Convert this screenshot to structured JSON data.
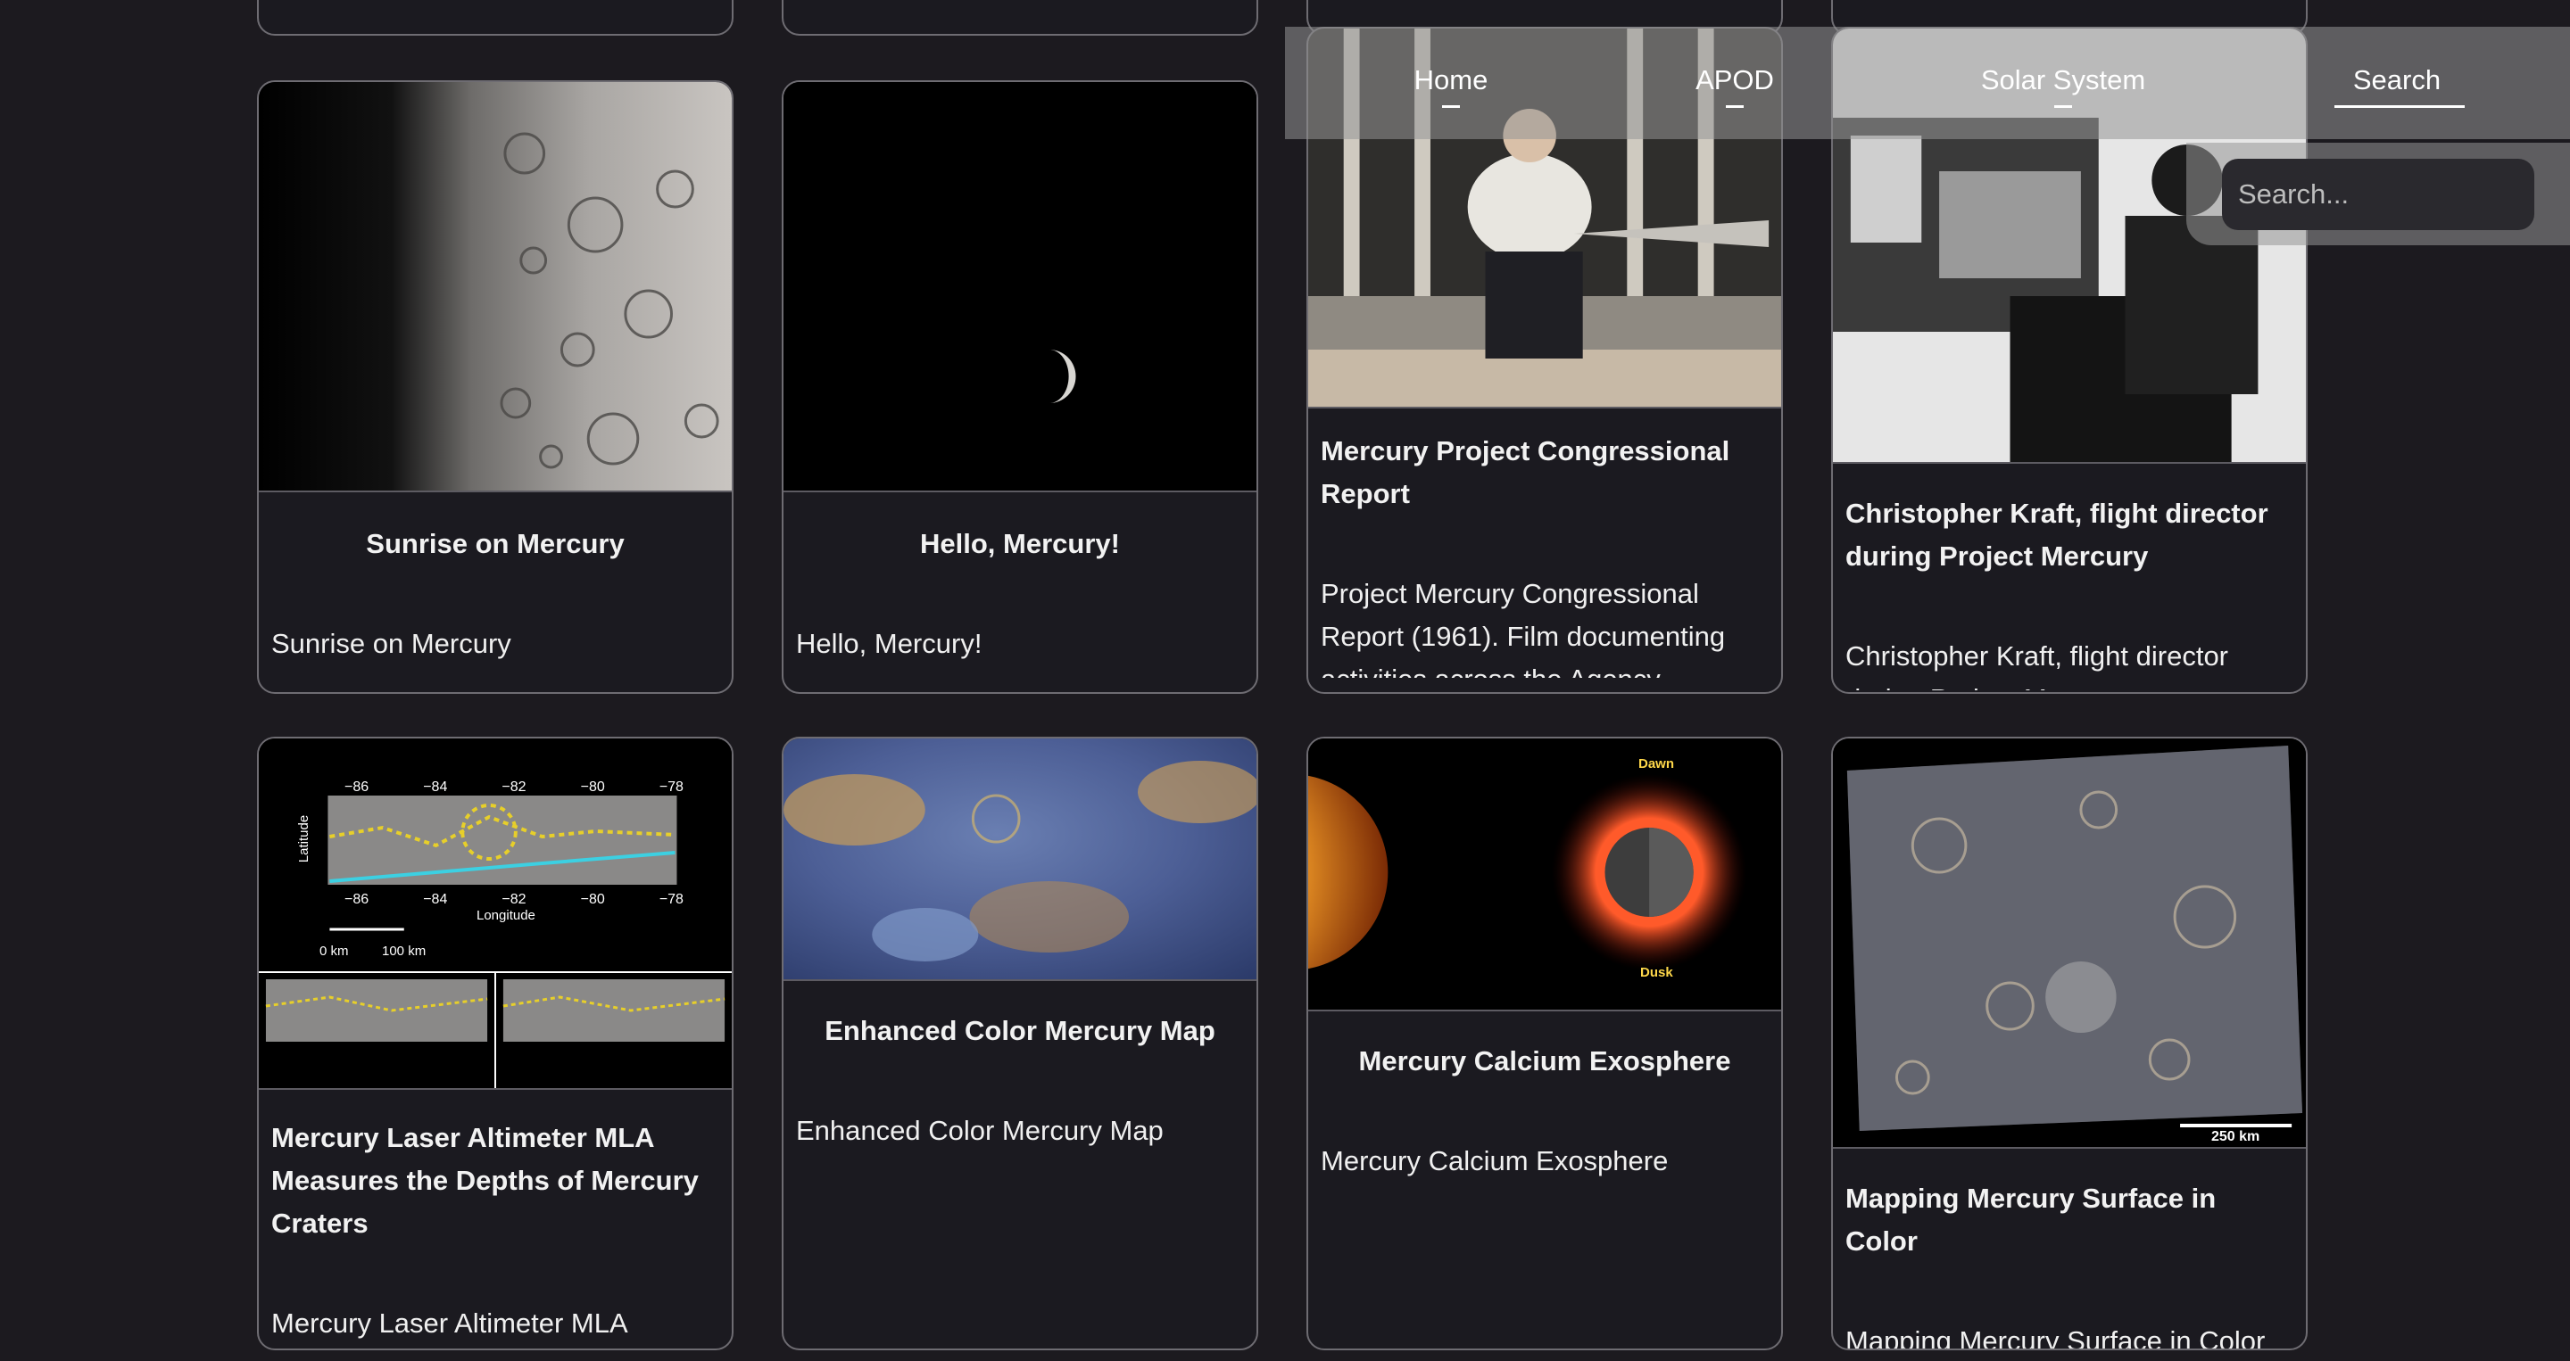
{
  "nav": {
    "items": [
      {
        "label": "Home"
      },
      {
        "label": "APOD"
      },
      {
        "label": "Solar System"
      },
      {
        "label": "Search"
      }
    ],
    "active": "Search",
    "search_placeholder": "Search..."
  },
  "cards": [
    {
      "title": "Sunrise on Mercury",
      "description": "Sunrise on Mercury"
    },
    {
      "title": "Hello, Mercury!",
      "description": "Hello, Mercury!"
    },
    {
      "title": "Mercury Project Congressional Report",
      "description": "Project Mercury Congressional Report (1961). Film documenting activities across the Agency"
    },
    {
      "title": "Christopher Kraft, flight director during Project Mercury",
      "description": "Christopher Kraft, flight director during Project Mercury"
    },
    {
      "title": "Mercury Laser Altimeter MLA Measures the Depths of Mercury Craters",
      "description": "Mercury Laser Altimeter MLA"
    },
    {
      "title": "Enhanced Color Mercury Map",
      "description": "Enhanced Color Mercury Map"
    },
    {
      "title": "Mercury Calcium Exosphere",
      "description": "Mercury Calcium Exosphere"
    },
    {
      "title": "Mapping Mercury Surface in Color",
      "description": "Mapping Mercury Surface in Color"
    }
  ],
  "image_labels": {
    "mla_ticks": [
      "−86",
      "−84",
      "−82",
      "−80",
      "−78"
    ],
    "mla_axis_x": "Longitude",
    "mla_axis_y": "Latitude",
    "mla_scale": [
      "0 km",
      "100 km"
    ],
    "exosphere_top": "Dawn",
    "exosphere_bottom": "Dusk",
    "mapping_scale": "250 km"
  }
}
